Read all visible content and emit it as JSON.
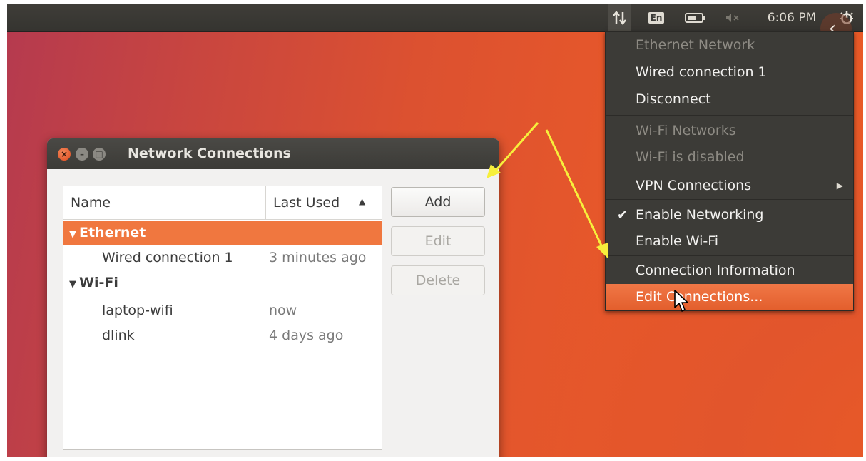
{
  "panel": {
    "language": "En",
    "clock": "6:06 PM",
    "icons": {
      "network": "network-arrows-icon",
      "battery": "battery-icon",
      "volume": "volume-muted-icon",
      "power": "power-gear-icon",
      "back": "chevron-left-icon"
    }
  },
  "network_menu": {
    "items": [
      {
        "label": "Ethernet Network",
        "enabled": false
      },
      {
        "label": "Wired connection 1",
        "enabled": true
      },
      {
        "label": "Disconnect",
        "enabled": true
      },
      {
        "label": "Wi-Fi Networks",
        "enabled": false
      },
      {
        "label": "Wi-Fi is disabled",
        "enabled": false
      },
      {
        "label": "VPN Connections",
        "enabled": true,
        "submenu": true
      },
      {
        "label": "Enable Networking",
        "enabled": true,
        "checked": true
      },
      {
        "label": "Enable Wi-Fi",
        "enabled": true
      },
      {
        "label": "Connection Information",
        "enabled": true
      },
      {
        "label": "Edit Connections...",
        "enabled": true,
        "highlighted": true
      }
    ]
  },
  "window": {
    "title": "Network Connections",
    "columns": {
      "name": "Name",
      "last_used": "Last Used"
    },
    "rows": [
      {
        "type": "group",
        "name": "Ethernet",
        "selected": true
      },
      {
        "type": "child",
        "name": "Wired connection 1",
        "last_used": "3 minutes ago"
      },
      {
        "type": "group",
        "name": "Wi-Fi"
      },
      {
        "type": "child",
        "name": "laptop-wifi",
        "last_used": "now"
      },
      {
        "type": "child",
        "name": "dlink",
        "last_used": "4 days ago"
      }
    ],
    "buttons": {
      "add": "Add",
      "edit": "Edit",
      "delete": "Delete"
    }
  },
  "colors": {
    "accent": "#f0773f",
    "panel": "#3c3b37",
    "annotation_arrow": "#f7ef3c"
  }
}
